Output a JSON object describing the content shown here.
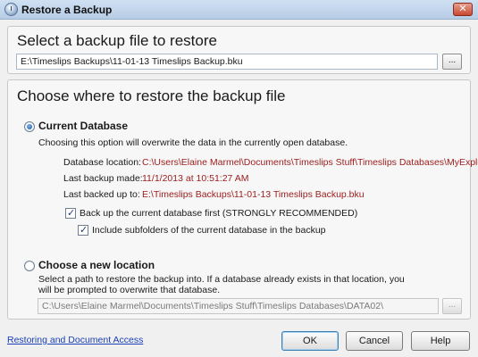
{
  "window": {
    "title": "Restore a Backup",
    "close_label": "✕"
  },
  "select_section": {
    "heading": "Select a backup file to restore",
    "file_path": "E:\\Timeslips Backups\\11-01-13 Timeslips Backup.bku",
    "browse_label": "..."
  },
  "restore_section": {
    "heading": "Choose where to restore the backup file",
    "current_db": {
      "label": "Current Database",
      "description": "Choosing this option will overwrite the data in the currently open database.",
      "location_label": "Database location:",
      "location_value": "C:\\Users\\Elaine Marmel\\Documents\\Timeslips Stuff\\Timeslips Databases\\MyExplore",
      "last_backup_label": "Last backup made:",
      "last_backup_value": "11/1/2013 at 10:51:27 AM",
      "backed_up_to_label": "Last backed up to:",
      "backed_up_to_value": "E:\\Timeslips Backups\\11-01-13 Timeslips Backup.bku",
      "backup_first_label": "Back up the current database first (STRONGLY RECOMMENDED)",
      "include_subfolders_label": "Include subfolders of the current database in the backup"
    },
    "new_location": {
      "label": "Choose a new location",
      "description_line1": "Select a path to restore the backup into. If a database already exists in that location, you",
      "description_line2": "will be prompted to overwrite that database.",
      "path": "C:\\Users\\Elaine Marmel\\Documents\\Timeslips Stuff\\Timeslips Databases\\DATA02\\",
      "browse_label": "..."
    }
  },
  "footer": {
    "link_label": "Restoring and Document Access",
    "ok_label": "OK",
    "cancel_label": "Cancel",
    "help_label": "Help"
  },
  "state": {
    "selected_option": "Current Database",
    "backup_first_checked": true,
    "include_subfolders_checked": true
  },
  "colors": {
    "value_text": "#9c1c1c",
    "link": "#1a3fb5",
    "title_bar": "#c4d7ec"
  }
}
